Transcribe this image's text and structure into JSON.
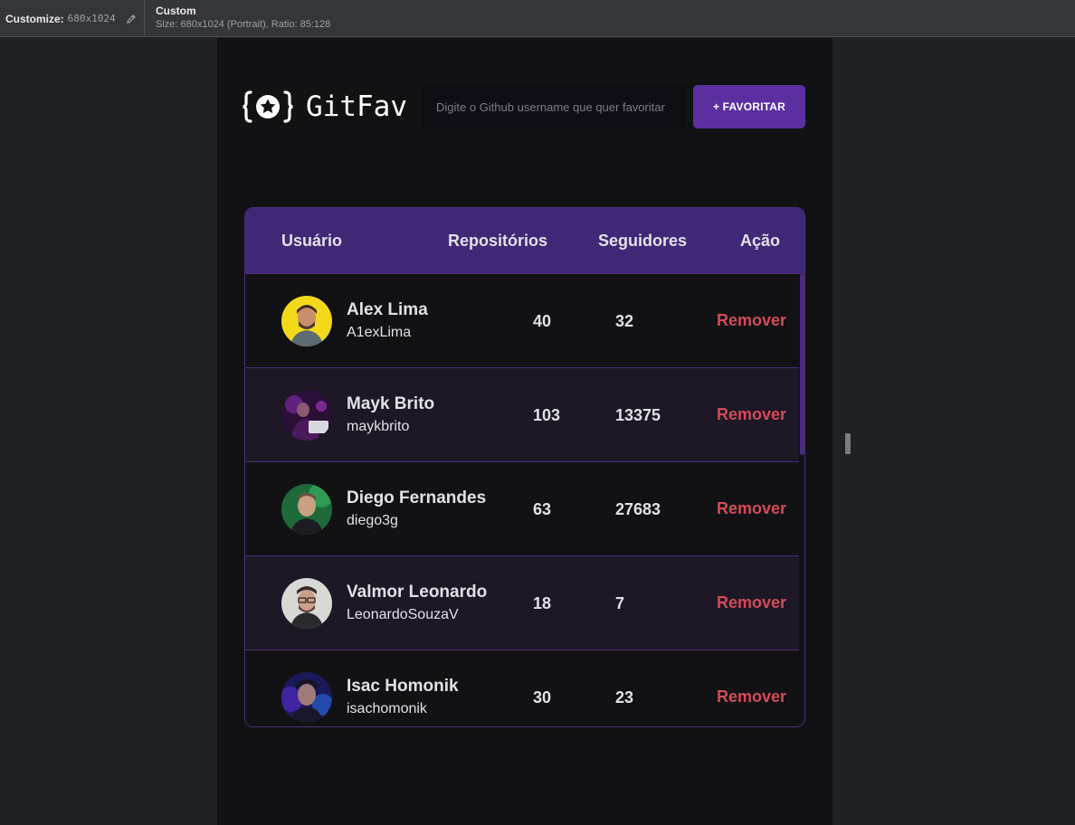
{
  "devtools": {
    "customize_label": "Customize:",
    "customize_value": "680x1024",
    "preset_title": "Custom",
    "preset_info": "Size: 680x1024 (Portrait), Ratio: 85:128"
  },
  "app": {
    "logo_text": "GitFav",
    "search_placeholder": "Digite o Github username que quer favoritar",
    "favorite_button": "+ FAVORITAR",
    "accent_color": "#5c2fa0",
    "remove_color": "#d44a5a"
  },
  "table": {
    "headers": {
      "user": "Usuário",
      "repos": "Repositórios",
      "followers": "Seguidores",
      "action": "Ação"
    },
    "rows": [
      {
        "name": "Alex Lima",
        "login": "A1exLima",
        "repos": "40",
        "followers": "32",
        "action": "Remover"
      },
      {
        "name": "Mayk Brito",
        "login": "maykbrito",
        "repos": "103",
        "followers": "13375",
        "action": "Remover"
      },
      {
        "name": "Diego Fernandes",
        "login": "diego3g",
        "repos": "63",
        "followers": "27683",
        "action": "Remover"
      },
      {
        "name": "Valmor Leonardo",
        "login": "LeonardoSouzaV",
        "repos": "18",
        "followers": "7",
        "action": "Remover"
      },
      {
        "name": "Isac Homonik",
        "login": "isachomonik",
        "repos": "30",
        "followers": "23",
        "action": "Remover"
      }
    ]
  }
}
